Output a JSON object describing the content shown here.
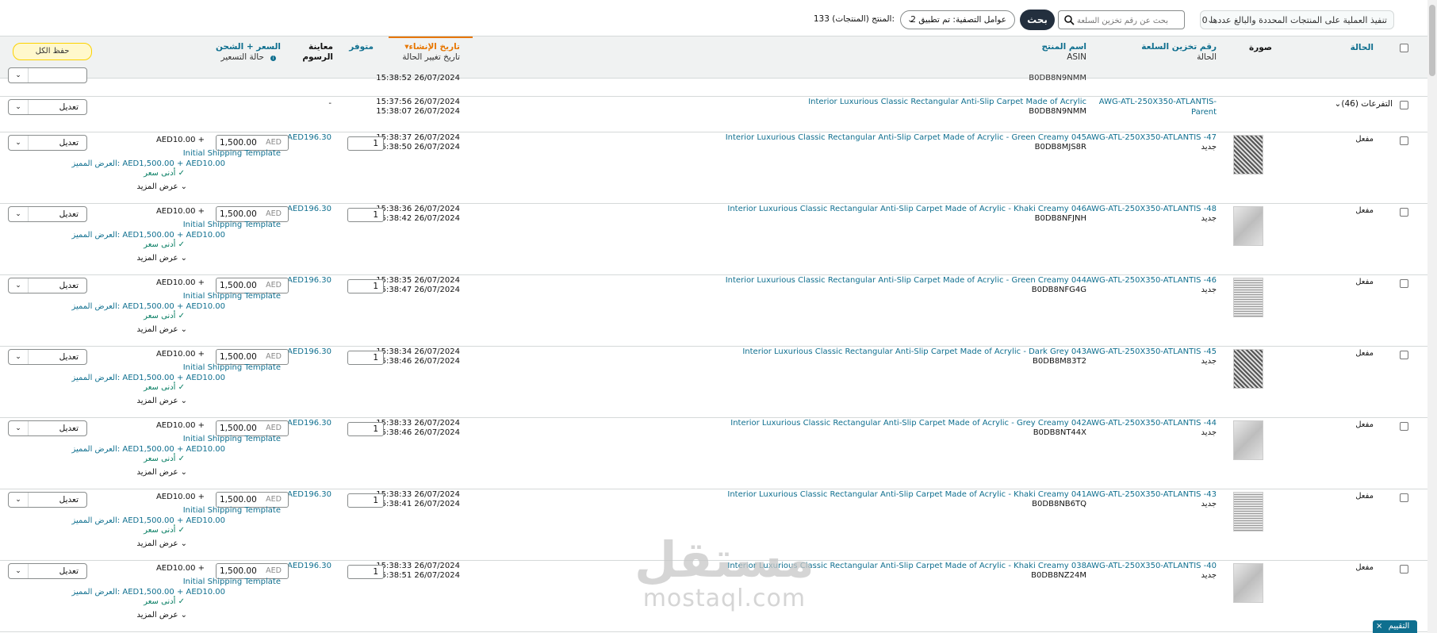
{
  "toolbar": {
    "bulk_action": "تنفيذ العملية على المنتجات المحددة والبالغ عددها 0",
    "search_placeholder": "بحث عن رقم تخزين السلعة",
    "search_button": "بحث",
    "filters_label": "عوامل التصفية: تم تطبيق 2",
    "product_count": "133 المنتج (المنتجات):"
  },
  "header": {
    "status": "الحالة",
    "image": "صورة",
    "sku": "رقم تخزين السلعة",
    "sku_sub": "الحالة",
    "product_name": "اسم المنتج",
    "product_name_sub": "ASIN",
    "created": "تاريخ الإنشاء",
    "created_sub": "تاريخ تغيير الحالة",
    "available": "متوفر",
    "fee_preview": "معاينة الرسوم",
    "price_shipping": "السعر + الشحن",
    "price_shipping_sub": "حالة التسعير",
    "save_all": "حفظ الكل"
  },
  "partial_row": {
    "date": "15:38:52 26/07/2024",
    "asin": "B0DB8N9NMM"
  },
  "parent_row": {
    "variations": "التفرعات (46)",
    "sku": "AWG-ATL-250X350-ATLANTIS-Parent",
    "name": "Interior Luxurious Classic Rectangular Anti-Slip Carpet Made of Acrylic",
    "asin": "B0DB8N9NMM",
    "created": "15:37:56 26/07/2024",
    "changed": "15:38:07 26/07/2024",
    "fee": "-",
    "edit": "تعديل"
  },
  "common": {
    "status": "مفعل",
    "condition": "جديد",
    "fee": "AED196.30",
    "currency": "AED",
    "price": "1,500.00",
    "shipping": "AED10.00 +",
    "template": "Initial Shipping Template",
    "featured_label": "العرض المميز:",
    "featured_value": "AED1,500.00 + AED10.00",
    "lowest": "أدنى سعر",
    "show_more": "عرض المزيد",
    "edit": "تعديل",
    "qty": "1"
  },
  "rows": [
    {
      "sku": "AWG-ATL-250X350-ATLANTIS -47",
      "name": "Interior Luxurious Classic Rectangular Anti-Slip Carpet Made of Acrylic - Green Creamy 045",
      "asin": "B0DB8MJS8R",
      "created": "15:38:37 26/07/2024",
      "changed": "15:38:50 26/07/2024",
      "thumb": "dark"
    },
    {
      "sku": "AWG-ATL-250X350-ATLANTIS -48",
      "name": "Interior Luxurious Classic Rectangular Anti-Slip Carpet Made of Acrylic - Khaki Creamy 046",
      "asin": "B0DB8NFJNH",
      "created": "15:38:36 26/07/2024",
      "changed": "15:38:42 26/07/2024",
      "thumb": "light"
    },
    {
      "sku": "AWG-ATL-250X350-ATLANTIS -46",
      "name": "Interior Luxurious Classic Rectangular Anti-Slip Carpet Made of Acrylic - Green Creamy 044",
      "asin": "B0DB8NFG4G",
      "created": "15:38:35 26/07/2024",
      "changed": "15:38:47 26/07/2024",
      "thumb": "pattern"
    },
    {
      "sku": "AWG-ATL-250X350-ATLANTIS -45",
      "name": "Interior Luxurious Classic Rectangular Anti-Slip Carpet Made of Acrylic - Dark Grey 043",
      "asin": "B0DB8M83T2",
      "created": "15:38:34 26/07/2024",
      "changed": "15:38:46 26/07/2024",
      "thumb": "dark"
    },
    {
      "sku": "AWG-ATL-250X350-ATLANTIS -44",
      "name": "Interior Luxurious Classic Rectangular Anti-Slip Carpet Made of Acrylic - Grey Creamy 042",
      "asin": "B0DB8NT44X",
      "created": "15:38:33 26/07/2024",
      "changed": "15:38:46 26/07/2024",
      "thumb": "light"
    },
    {
      "sku": "AWG-ATL-250X350-ATLANTIS -43",
      "name": "Interior Luxurious Classic Rectangular Anti-Slip Carpet Made of Acrylic - Khaki Creamy 041",
      "asin": "B0DB8NB6TQ",
      "created": "15:38:33 26/07/2024",
      "changed": "15:38:41 26/07/2024",
      "thumb": "pattern"
    },
    {
      "sku": "AWG-ATL-250X350-ATLANTIS -40",
      "name": "Interior Luxurious Classic Rectangular Anti-Slip Carpet Made of Acrylic - Khaki Creamy 038",
      "asin": "B0DB8NZ24M",
      "created": "15:38:33 26/07/2024",
      "changed": "15:38:51 26/07/2024",
      "thumb": "light"
    }
  ],
  "watermark": {
    "arabic": "مستقل",
    "latin": "mostaql.com"
  },
  "feedback": "التقييم",
  "colors": {
    "link": "#0f6f8f",
    "header_bg": "#f0f2f2",
    "accent": "#e77600",
    "check": "#067d62"
  }
}
